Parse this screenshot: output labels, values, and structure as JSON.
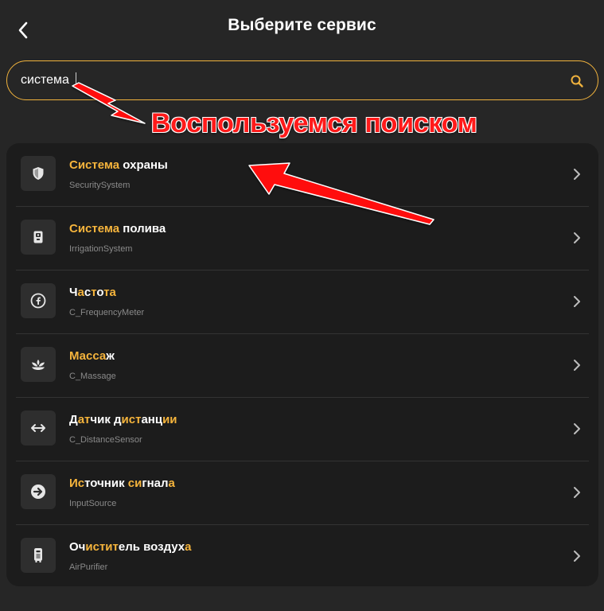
{
  "header": {
    "title": "Выберите сервис"
  },
  "search": {
    "value": "система",
    "placeholder": ""
  },
  "annotation": {
    "text": "Воспользуемся поиском",
    "color": "#ff1a1a"
  },
  "colors": {
    "accent": "#f5b43c",
    "background": "#262626",
    "panel": "#1c1c1c"
  },
  "services": [
    {
      "title_parts": [
        {
          "t": "Система",
          "h": true
        },
        {
          "t": " охраны",
          "h": false
        }
      ],
      "subtitle": "SecuritySystem",
      "icon": "shield-icon"
    },
    {
      "title_parts": [
        {
          "t": "Система",
          "h": true
        },
        {
          "t": " полива",
          "h": false
        }
      ],
      "subtitle": "IrrigationSystem",
      "icon": "irrigation-icon"
    },
    {
      "title_parts": [
        {
          "t": "Ч",
          "h": false
        },
        {
          "t": "а",
          "h": true
        },
        {
          "t": "с",
          "h": false
        },
        {
          "t": "т",
          "h": true
        },
        {
          "t": "о",
          "h": false
        },
        {
          "t": "та",
          "h": true
        }
      ],
      "subtitle": "C_FrequencyMeter",
      "icon": "frequency-icon"
    },
    {
      "title_parts": [
        {
          "t": "Масса",
          "h": true
        },
        {
          "t": "ж",
          "h": false
        }
      ],
      "subtitle": "C_Massage",
      "icon": "massage-icon"
    },
    {
      "title_parts": [
        {
          "t": "Д",
          "h": false
        },
        {
          "t": "ат",
          "h": true
        },
        {
          "t": "чик д",
          "h": false
        },
        {
          "t": "ист",
          "h": true
        },
        {
          "t": "анц",
          "h": false
        },
        {
          "t": "ии",
          "h": true
        }
      ],
      "subtitle": "C_DistanceSensor",
      "icon": "distance-icon"
    },
    {
      "title_parts": [
        {
          "t": "Ис",
          "h": true
        },
        {
          "t": "т",
          "h": false
        },
        {
          "t": "о",
          "h": false
        },
        {
          "t": "чник ",
          "h": false
        },
        {
          "t": "си",
          "h": true
        },
        {
          "t": "г",
          "h": false
        },
        {
          "t": "нал",
          "h": false
        },
        {
          "t": "а",
          "h": true
        }
      ],
      "subtitle": "InputSource",
      "icon": "input-source-icon"
    },
    {
      "title_parts": [
        {
          "t": "Оч",
          "h": false
        },
        {
          "t": "истит",
          "h": true
        },
        {
          "t": "ель воздух",
          "h": false
        },
        {
          "t": "а",
          "h": true
        }
      ],
      "subtitle": "AirPurifier",
      "icon": "air-purifier-icon"
    }
  ]
}
